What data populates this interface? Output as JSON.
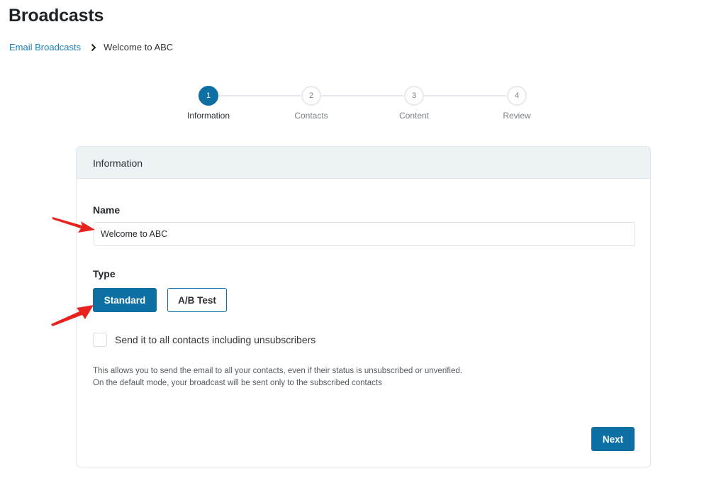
{
  "header": {
    "title": "Broadcasts"
  },
  "breadcrumb": {
    "parent": "Email Broadcasts",
    "current": "Welcome to ABC",
    "separator_icon": "chevron-right-icon"
  },
  "stepper": {
    "active_step": 1,
    "steps": [
      {
        "number": "1",
        "label": "Information"
      },
      {
        "number": "2",
        "label": "Contacts"
      },
      {
        "number": "3",
        "label": "Content"
      },
      {
        "number": "4",
        "label": "Review"
      }
    ]
  },
  "card": {
    "title": "Information",
    "name_field": {
      "label": "Name",
      "value": "Welcome to ABC",
      "placeholder": ""
    },
    "type_field": {
      "label": "Type",
      "options": [
        {
          "label": "Standard",
          "selected": true
        },
        {
          "label": "A/B Test",
          "selected": false
        }
      ]
    },
    "send_all": {
      "label": "Send it to all contacts including unsubscribers",
      "checked": false
    },
    "help_text": {
      "line1": "This allows you to send the email to all your contacts, even if their status is unsubscribed or unverified.",
      "line2": "On the default mode, your broadcast will be sent only to the subscribed contacts"
    },
    "next_label": "Next"
  },
  "annotations": {
    "arrow_color": "#e8231f"
  },
  "colors": {
    "primary": "#0e6fa3",
    "link": "#1a7fb5",
    "header_bg": "#edf2f5"
  }
}
